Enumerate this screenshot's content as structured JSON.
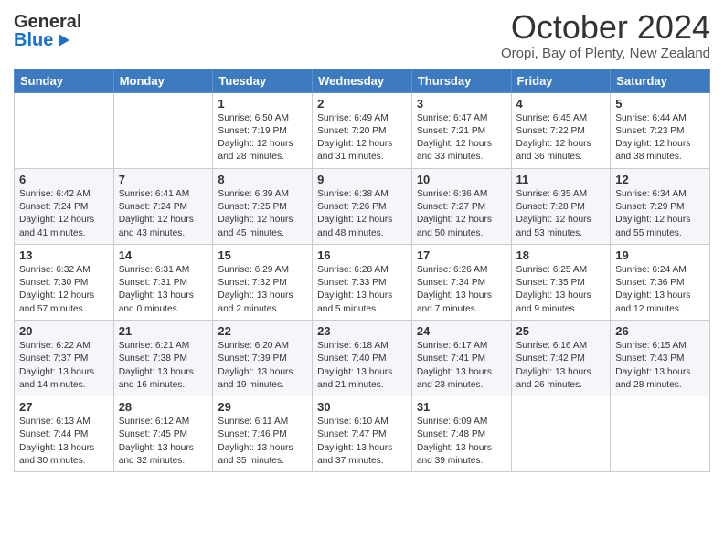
{
  "logo": {
    "line1": "General",
    "line2": "Blue"
  },
  "title": "October 2024",
  "subtitle": "Oropi, Bay of Plenty, New Zealand",
  "days_of_week": [
    "Sunday",
    "Monday",
    "Tuesday",
    "Wednesday",
    "Thursday",
    "Friday",
    "Saturday"
  ],
  "weeks": [
    [
      {
        "day": "",
        "info": ""
      },
      {
        "day": "",
        "info": ""
      },
      {
        "day": "1",
        "info": "Sunrise: 6:50 AM\nSunset: 7:19 PM\nDaylight: 12 hours and 28 minutes."
      },
      {
        "day": "2",
        "info": "Sunrise: 6:49 AM\nSunset: 7:20 PM\nDaylight: 12 hours and 31 minutes."
      },
      {
        "day": "3",
        "info": "Sunrise: 6:47 AM\nSunset: 7:21 PM\nDaylight: 12 hours and 33 minutes."
      },
      {
        "day": "4",
        "info": "Sunrise: 6:45 AM\nSunset: 7:22 PM\nDaylight: 12 hours and 36 minutes."
      },
      {
        "day": "5",
        "info": "Sunrise: 6:44 AM\nSunset: 7:23 PM\nDaylight: 12 hours and 38 minutes."
      }
    ],
    [
      {
        "day": "6",
        "info": "Sunrise: 6:42 AM\nSunset: 7:24 PM\nDaylight: 12 hours and 41 minutes."
      },
      {
        "day": "7",
        "info": "Sunrise: 6:41 AM\nSunset: 7:24 PM\nDaylight: 12 hours and 43 minutes."
      },
      {
        "day": "8",
        "info": "Sunrise: 6:39 AM\nSunset: 7:25 PM\nDaylight: 12 hours and 45 minutes."
      },
      {
        "day": "9",
        "info": "Sunrise: 6:38 AM\nSunset: 7:26 PM\nDaylight: 12 hours and 48 minutes."
      },
      {
        "day": "10",
        "info": "Sunrise: 6:36 AM\nSunset: 7:27 PM\nDaylight: 12 hours and 50 minutes."
      },
      {
        "day": "11",
        "info": "Sunrise: 6:35 AM\nSunset: 7:28 PM\nDaylight: 12 hours and 53 minutes."
      },
      {
        "day": "12",
        "info": "Sunrise: 6:34 AM\nSunset: 7:29 PM\nDaylight: 12 hours and 55 minutes."
      }
    ],
    [
      {
        "day": "13",
        "info": "Sunrise: 6:32 AM\nSunset: 7:30 PM\nDaylight: 12 hours and 57 minutes."
      },
      {
        "day": "14",
        "info": "Sunrise: 6:31 AM\nSunset: 7:31 PM\nDaylight: 13 hours and 0 minutes."
      },
      {
        "day": "15",
        "info": "Sunrise: 6:29 AM\nSunset: 7:32 PM\nDaylight: 13 hours and 2 minutes."
      },
      {
        "day": "16",
        "info": "Sunrise: 6:28 AM\nSunset: 7:33 PM\nDaylight: 13 hours and 5 minutes."
      },
      {
        "day": "17",
        "info": "Sunrise: 6:26 AM\nSunset: 7:34 PM\nDaylight: 13 hours and 7 minutes."
      },
      {
        "day": "18",
        "info": "Sunrise: 6:25 AM\nSunset: 7:35 PM\nDaylight: 13 hours and 9 minutes."
      },
      {
        "day": "19",
        "info": "Sunrise: 6:24 AM\nSunset: 7:36 PM\nDaylight: 13 hours and 12 minutes."
      }
    ],
    [
      {
        "day": "20",
        "info": "Sunrise: 6:22 AM\nSunset: 7:37 PM\nDaylight: 13 hours and 14 minutes."
      },
      {
        "day": "21",
        "info": "Sunrise: 6:21 AM\nSunset: 7:38 PM\nDaylight: 13 hours and 16 minutes."
      },
      {
        "day": "22",
        "info": "Sunrise: 6:20 AM\nSunset: 7:39 PM\nDaylight: 13 hours and 19 minutes."
      },
      {
        "day": "23",
        "info": "Sunrise: 6:18 AM\nSunset: 7:40 PM\nDaylight: 13 hours and 21 minutes."
      },
      {
        "day": "24",
        "info": "Sunrise: 6:17 AM\nSunset: 7:41 PM\nDaylight: 13 hours and 23 minutes."
      },
      {
        "day": "25",
        "info": "Sunrise: 6:16 AM\nSunset: 7:42 PM\nDaylight: 13 hours and 26 minutes."
      },
      {
        "day": "26",
        "info": "Sunrise: 6:15 AM\nSunset: 7:43 PM\nDaylight: 13 hours and 28 minutes."
      }
    ],
    [
      {
        "day": "27",
        "info": "Sunrise: 6:13 AM\nSunset: 7:44 PM\nDaylight: 13 hours and 30 minutes."
      },
      {
        "day": "28",
        "info": "Sunrise: 6:12 AM\nSunset: 7:45 PM\nDaylight: 13 hours and 32 minutes."
      },
      {
        "day": "29",
        "info": "Sunrise: 6:11 AM\nSunset: 7:46 PM\nDaylight: 13 hours and 35 minutes."
      },
      {
        "day": "30",
        "info": "Sunrise: 6:10 AM\nSunset: 7:47 PM\nDaylight: 13 hours and 37 minutes."
      },
      {
        "day": "31",
        "info": "Sunrise: 6:09 AM\nSunset: 7:48 PM\nDaylight: 13 hours and 39 minutes."
      },
      {
        "day": "",
        "info": ""
      },
      {
        "day": "",
        "info": ""
      }
    ]
  ]
}
